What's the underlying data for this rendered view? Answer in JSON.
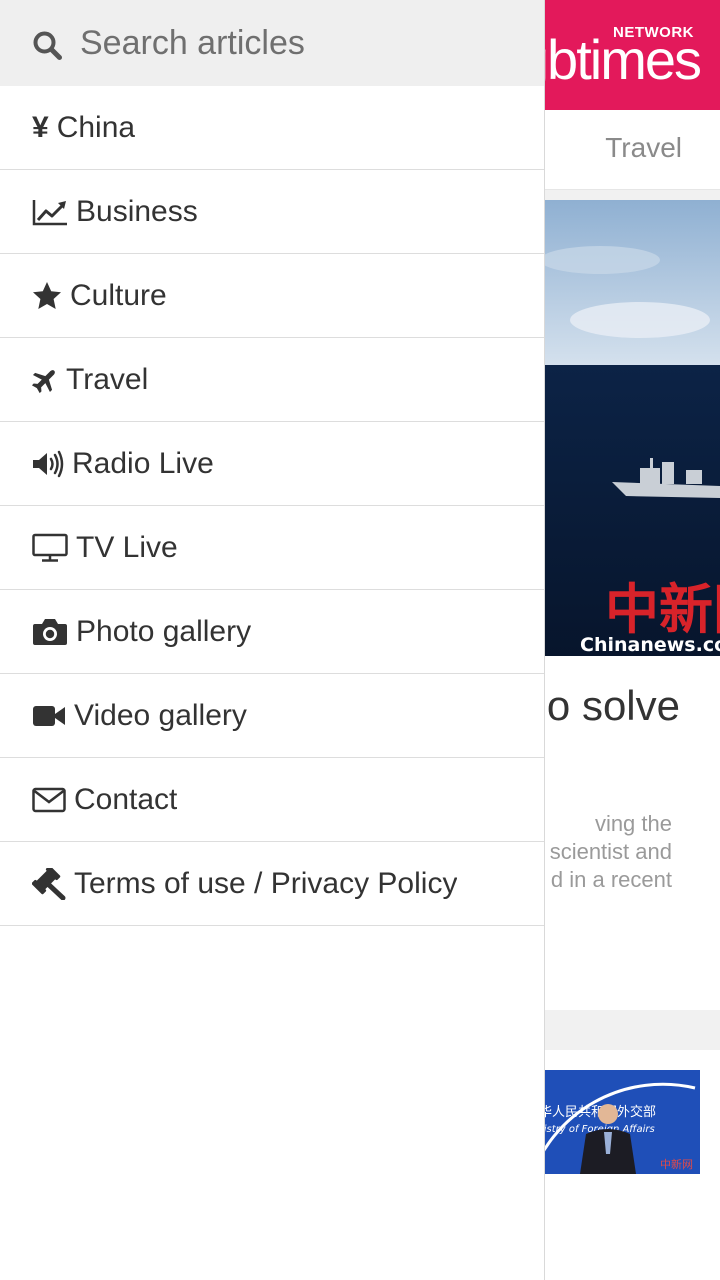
{
  "background": {
    "brand_network": "NETWORK",
    "brand_name": "gbtimes",
    "tab_visible": "Travel",
    "article": {
      "title_fragment": "o solve",
      "excerpt_fragments": [
        "ving the",
        "scientist and",
        "d in a recent"
      ],
      "photo_watermark": "Chinanews.com",
      "photo_watermark_cn": "中新网"
    },
    "thumb_caption_cn": "中华人民共和国外交部",
    "thumb_caption_en": "Ministry of Foreign Affairs",
    "colors": {
      "brand": "#e3195b",
      "sea": "#0d1e3c",
      "sky": "#a9c4df"
    }
  },
  "drawer": {
    "search": {
      "placeholder": "Search articles",
      "value": "",
      "icon": "search-icon"
    },
    "items": [
      {
        "label": "China",
        "icon": "yen-icon"
      },
      {
        "label": "Business",
        "icon": "chart-line-icon"
      },
      {
        "label": "Culture",
        "icon": "star-icon"
      },
      {
        "label": "Travel",
        "icon": "plane-icon"
      },
      {
        "label": "Radio Live",
        "icon": "volume-icon"
      },
      {
        "label": "TV Live",
        "icon": "tv-icon"
      },
      {
        "label": "Photo gallery",
        "icon": "camera-icon"
      },
      {
        "label": "Video gallery",
        "icon": "video-camera-icon"
      },
      {
        "label": "Contact",
        "icon": "envelope-icon"
      },
      {
        "label": "Terms of use / Privacy Policy",
        "icon": "gavel-icon"
      }
    ]
  }
}
